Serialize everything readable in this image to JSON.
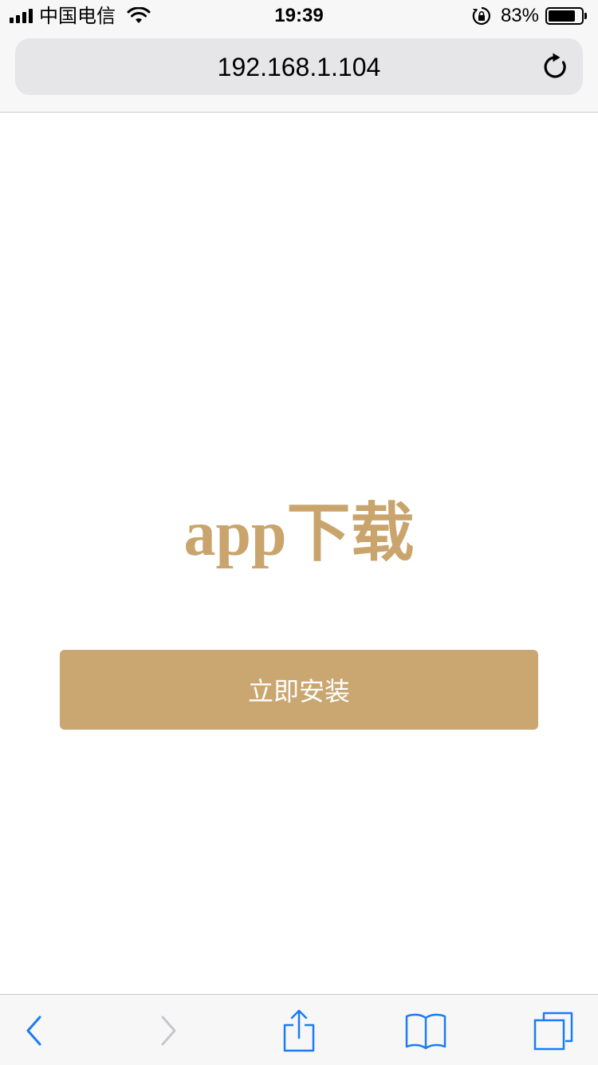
{
  "status_bar": {
    "carrier": "中国电信",
    "time": "19:39",
    "battery_percent": "83%",
    "battery_level": 0.83,
    "icons": [
      "signal-icon",
      "wifi-icon",
      "rotation-lock-icon",
      "battery-icon"
    ]
  },
  "address_bar": {
    "url": "192.168.1.104",
    "reload_icon": "reload-icon"
  },
  "main": {
    "headline": "app下载",
    "install_button_label": "立即安装"
  },
  "toolbar": {
    "items": [
      "back-icon",
      "forward-icon",
      "share-icon",
      "bookmarks-icon",
      "tabs-icon"
    ]
  },
  "colors": {
    "accent": "#caa670",
    "headline": "#c9a46c",
    "ios_blue": "#1a7cf5",
    "disabled": "#c7c7cc"
  }
}
